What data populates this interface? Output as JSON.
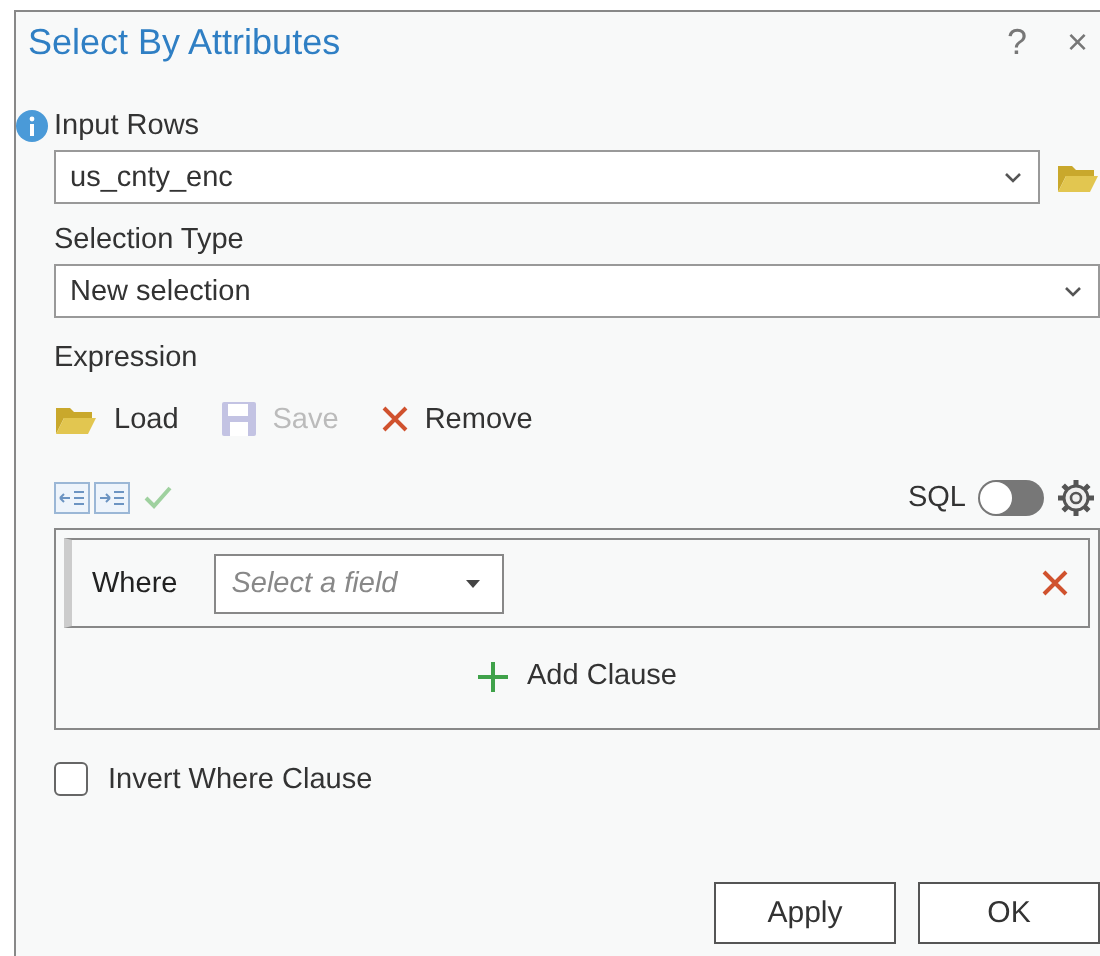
{
  "window": {
    "title": "Select By Attributes",
    "help": "?",
    "close": "×"
  },
  "input_rows": {
    "label": "Input Rows",
    "value": "us_cnty_enc"
  },
  "selection_type": {
    "label": "Selection Type",
    "value": "New selection"
  },
  "expression": {
    "label": "Expression",
    "tools": [
      {
        "kind": "load",
        "label": "Load",
        "disabled": false
      },
      {
        "kind": "save",
        "label": "Save",
        "disabled": true
      },
      {
        "kind": "remove",
        "label": "Remove",
        "disabled": false
      }
    ],
    "sql": {
      "label": "SQL",
      "on": false
    },
    "clauses": [
      {
        "keyword": "Where",
        "placeholder": "Select a field"
      }
    ],
    "add_clause": "Add Clause"
  },
  "invert": {
    "label": "Invert Where Clause",
    "checked": false
  },
  "buttons": [
    "Apply",
    "OK"
  ]
}
